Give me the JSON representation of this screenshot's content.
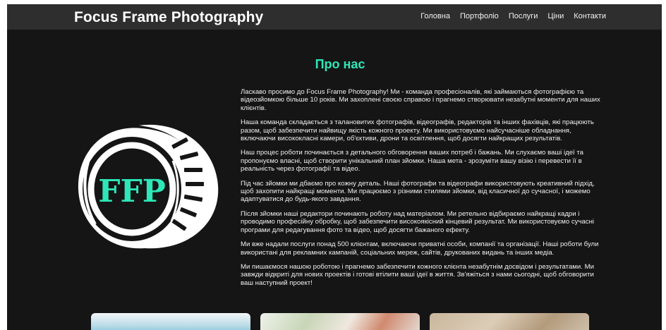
{
  "header": {
    "brand": "Focus Frame Photography",
    "nav": [
      "Головна",
      "Портфоліо",
      "Послуги",
      "Ціни",
      "Контакти"
    ]
  },
  "about": {
    "title": "Про нас",
    "logo_text": "FFP",
    "paragraphs": [
      "Ласкаво просимо до Focus Frame Photography! Ми - команда професіоналів, які займаються фотографією та відеозйомкою більше 10 років. Ми захоплені своєю справою і прагнемо створювати незабутні моменти для наших клієнтів.",
      "Наша команда складається з талановитих фотографів, відеографів, редакторів та інших фахівців, які працюють разом, щоб забезпечити найвищу якість кожного проекту. Ми використовуємо найсучасніше обладнання, включаючи висококласні камери, об'єктиви, дрони та освітлення, щоб досягти найкращих результатів.",
      "Наш процес роботи починається з детального обговорення ваших потреб і бажань. Ми слухаємо ваші ідеї та пропонуємо власні, щоб створити унікальний план зйомки. Наша мета - зрозуміти вашу візію і перевести її в реальність через фотографії та відео.",
      "Під час зйомки ми дбаємо про кожну деталь. Наші фотографи та відеографи використовують креативний підхід, щоб захопити найкращі моменти. Ми працюємо з різними стилями зйомки, від класичної до сучасної, і можемо адаптуватися до будь-якого завдання.",
      "Після зйомки наші редактори починають роботу над матеріалом. Ми ретельно відбираємо найкращі кадри і проводимо професійну обробку, щоб забезпечити високоякісний кінцевий результат. Ми використовуємо сучасні програми для редагування фото та відео, щоб досягти бажаного ефекту.",
      "Ми вже надали послуги понад 500 клієнтам, включаючи приватні особи, компанії та організації. Наші роботи були використані для рекламних кампаній, соціальних мереж, сайтів, друкованих видань та інших медіа.",
      "Ми пишаємося нашою роботою і прагнемо забезпечити кожного клієнта незабутнім досвідом і результатами. Ми завжди відкриті для нових проектів і готові втілити ваші ідеї в життя. Зв'яжіться з нами сьогодні, щоб обговорити ваш наступний проект!"
    ]
  },
  "colors": {
    "background": "#151515",
    "header": "#2e2e2e",
    "accent": "#2ee6b8"
  }
}
